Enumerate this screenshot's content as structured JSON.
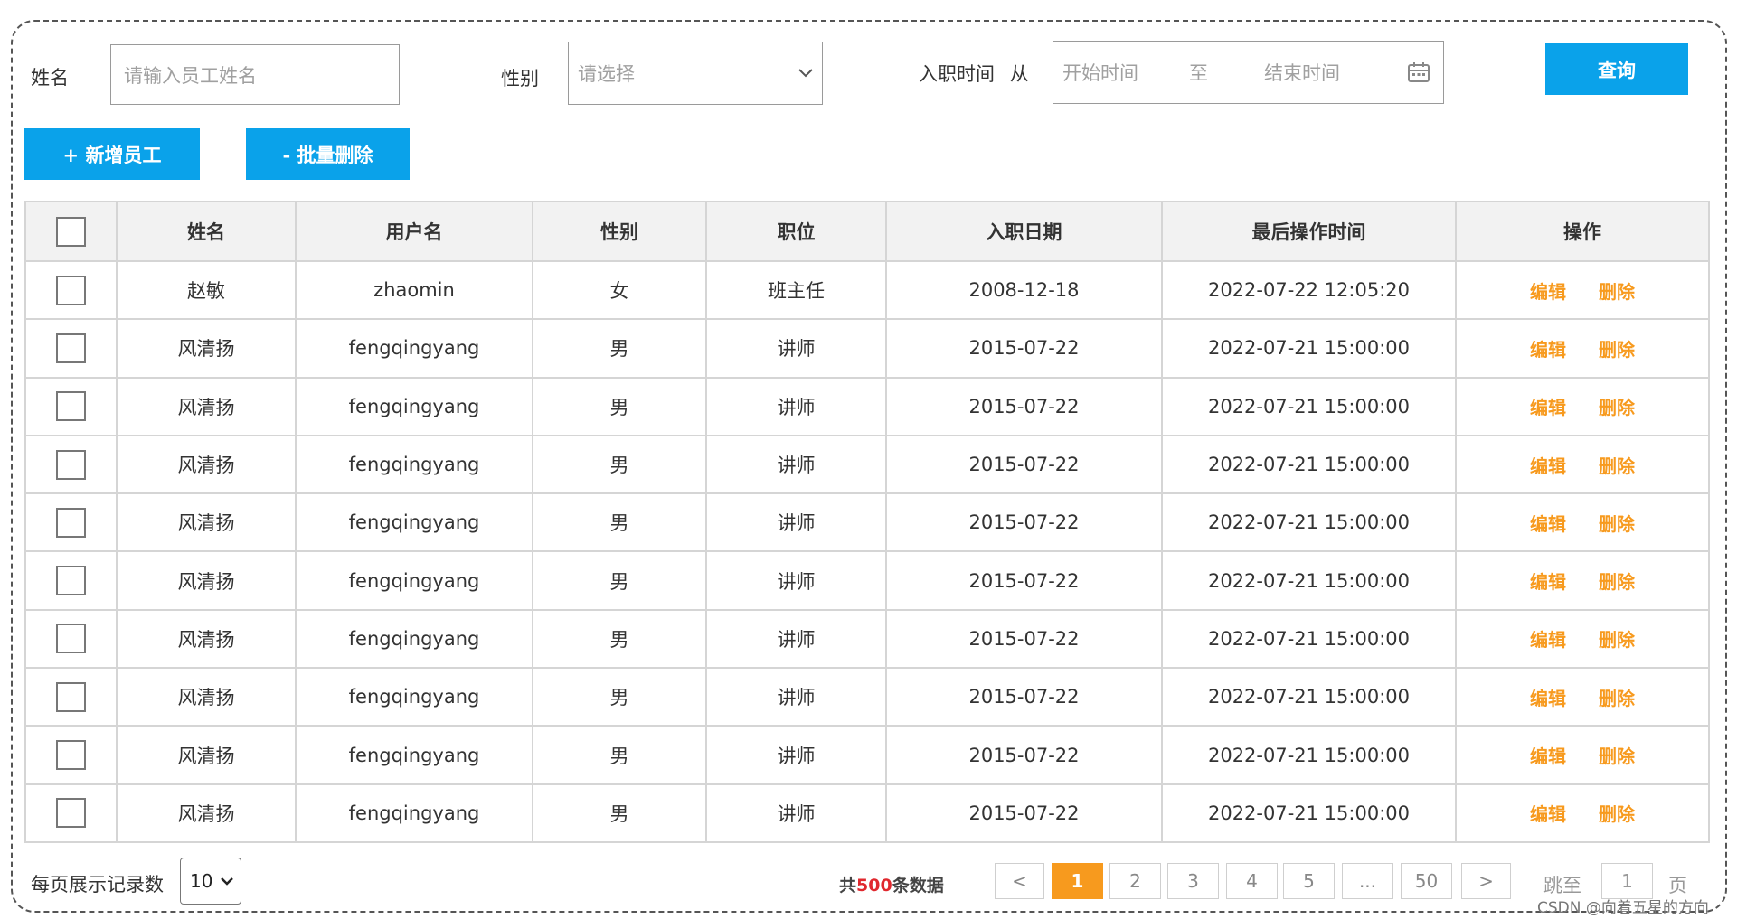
{
  "search": {
    "name_label": "姓名",
    "name_placeholder": "请输入员工姓名",
    "gender_label": "性别",
    "gender_placeholder": "请选择",
    "date_label": "入职时间",
    "date_from": "从",
    "date_start_placeholder": "开始时间",
    "date_to": "至",
    "date_end_placeholder": "结束时间",
    "query_button": "查询"
  },
  "toolbar": {
    "add_button": "+ 新增员工",
    "batch_delete_button": "- 批量删除"
  },
  "table": {
    "columns": [
      "姓名",
      "用户名",
      "性别",
      "职位",
      "入职日期",
      "最后操作时间",
      "操作"
    ],
    "action_edit": "编辑",
    "action_delete": "删除",
    "rows": [
      {
        "name": "赵敏",
        "username": "zhaomin",
        "gender": "女",
        "position": "班主任",
        "hire_date": "2008-12-18",
        "last_op": "2022-07-22 12:05:20"
      },
      {
        "name": "风清扬",
        "username": "fengqingyang",
        "gender": "男",
        "position": "讲师",
        "hire_date": "2015-07-22",
        "last_op": "2022-07-21 15:00:00"
      },
      {
        "name": "风清扬",
        "username": "fengqingyang",
        "gender": "男",
        "position": "讲师",
        "hire_date": "2015-07-22",
        "last_op": "2022-07-21 15:00:00"
      },
      {
        "name": "风清扬",
        "username": "fengqingyang",
        "gender": "男",
        "position": "讲师",
        "hire_date": "2015-07-22",
        "last_op": "2022-07-21 15:00:00"
      },
      {
        "name": "风清扬",
        "username": "fengqingyang",
        "gender": "男",
        "position": "讲师",
        "hire_date": "2015-07-22",
        "last_op": "2022-07-21 15:00:00"
      },
      {
        "name": "风清扬",
        "username": "fengqingyang",
        "gender": "男",
        "position": "讲师",
        "hire_date": "2015-07-22",
        "last_op": "2022-07-21 15:00:00"
      },
      {
        "name": "风清扬",
        "username": "fengqingyang",
        "gender": "男",
        "position": "讲师",
        "hire_date": "2015-07-22",
        "last_op": "2022-07-21 15:00:00"
      },
      {
        "name": "风清扬",
        "username": "fengqingyang",
        "gender": "男",
        "position": "讲师",
        "hire_date": "2015-07-22",
        "last_op": "2022-07-21 15:00:00"
      },
      {
        "name": "风清扬",
        "username": "fengqingyang",
        "gender": "男",
        "position": "讲师",
        "hire_date": "2015-07-22",
        "last_op": "2022-07-21 15:00:00"
      },
      {
        "name": "风清扬",
        "username": "fengqingyang",
        "gender": "男",
        "position": "讲师",
        "hire_date": "2015-07-22",
        "last_op": "2022-07-21 15:00:00"
      }
    ]
  },
  "pagination": {
    "page_size_label": "每页展示记录数",
    "page_size_value": "10",
    "total_prefix": "共",
    "total_count": "500",
    "total_suffix": "条数据",
    "prev": "<",
    "pages": [
      "1",
      "2",
      "3",
      "4",
      "5",
      "...",
      "50"
    ],
    "active_page": "1",
    "next": ">",
    "jump_label": "跳至",
    "jump_value": "1",
    "jump_suffix": "页"
  },
  "watermark": "CSDN @向着五星的方向",
  "colors": {
    "primary": "#0aa2ea",
    "action": "#f79a1e",
    "highlight": "#e0282e"
  }
}
